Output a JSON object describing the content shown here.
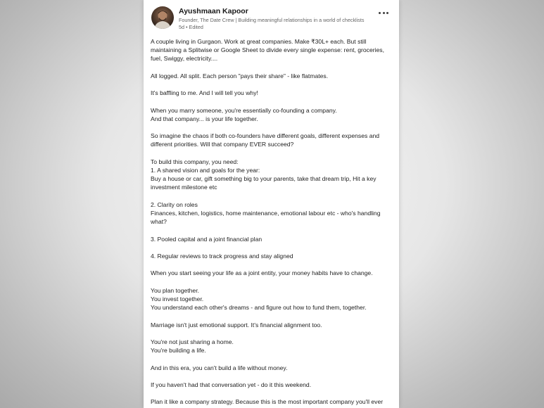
{
  "post": {
    "author": {
      "name": "Ayushmaan Kapoor",
      "tagline": "Founder, The Date Crew | Building meaningful relationships in a world of checklists",
      "time": "5d",
      "separator": "•",
      "edited": "Edited",
      "avatar_icon": "profile-photo"
    },
    "menu_icon": "more-horizontal-icon",
    "paragraphs": [
      "A couple living in Gurgaon. Work at great companies. Make ₹30L+ each. But still maintaining a Splitwise or Google Sheet to divide every single expense: rent, groceries, fuel, Swiggy, electricity....",
      "All logged. All split. Each person \"pays their share\" - like flatmates.",
      "It's baffling to me. And I will tell you why!",
      "When you marry someone, you're essentially co-founding a company.\nAnd that company... is your life together.",
      "So imagine the chaos if both co-founders have different goals, different expenses and different priorities. Will that company EVER succeed?",
      "To build this company, you need:\n1. A shared vision and goals for the year:\nBuy a house or car, gift something big to your parents, take that dream trip, Hit a key investment milestone etc",
      "2. Clarity on roles\nFinances, kitchen, logistics, home maintenance, emotional labour etc - who's handling what?",
      "3. Pooled capital and a joint financial plan",
      "4. Regular reviews to track progress and stay aligned",
      "When you start seeing your life as a joint entity, your money habits have to change.",
      "You plan together.\nYou invest together.\nYou understand each other's dreams - and figure out how to fund them, together.",
      "Marriage isn't just emotional support. It's financial alignment too.",
      "You're not just sharing a home.\nYou're building a life.",
      "And in this era, you can't build a life without money.",
      "If you haven't had that conversation yet - do it this weekend.",
      "Plan it like a company strategy. Because this is the most important company you'll ever build."
    ]
  }
}
